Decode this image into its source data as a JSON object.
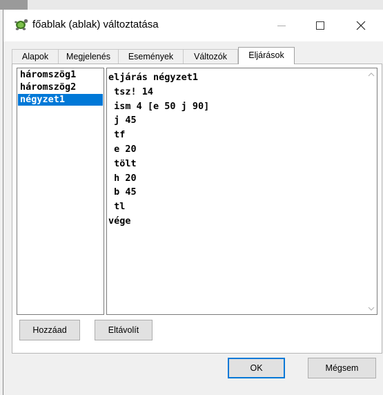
{
  "window": {
    "title": "főablak (ablak) változtatása",
    "icon": "turtle-app-icon",
    "controls": {
      "minimize": "minimize-icon",
      "maximize": "maximize-icon",
      "close": "close-icon"
    }
  },
  "tabs": [
    {
      "label": "Alapok",
      "active": false
    },
    {
      "label": "Megjelenés",
      "active": false
    },
    {
      "label": "Események",
      "active": false
    },
    {
      "label": "Változók",
      "active": false
    },
    {
      "label": "Eljárások",
      "active": true
    }
  ],
  "procedures": {
    "items": [
      "háromszög1",
      "háromszög2",
      "négyzet1"
    ],
    "selected": "négyzet1"
  },
  "editor": {
    "lines": [
      "eljárás négyzet1",
      " tsz! 14",
      " ism 4 [e 50 j 90]",
      " j 45",
      " tf",
      " e 20",
      " tölt",
      " h 20",
      " b 45",
      " tl",
      "vége"
    ]
  },
  "buttons": {
    "add": "Hozzáad",
    "remove": "Eltávolít",
    "ok": "OK",
    "cancel": "Mégsem"
  },
  "colors": {
    "selection": "#0078d7",
    "window_bg": "#f0f0f0"
  }
}
